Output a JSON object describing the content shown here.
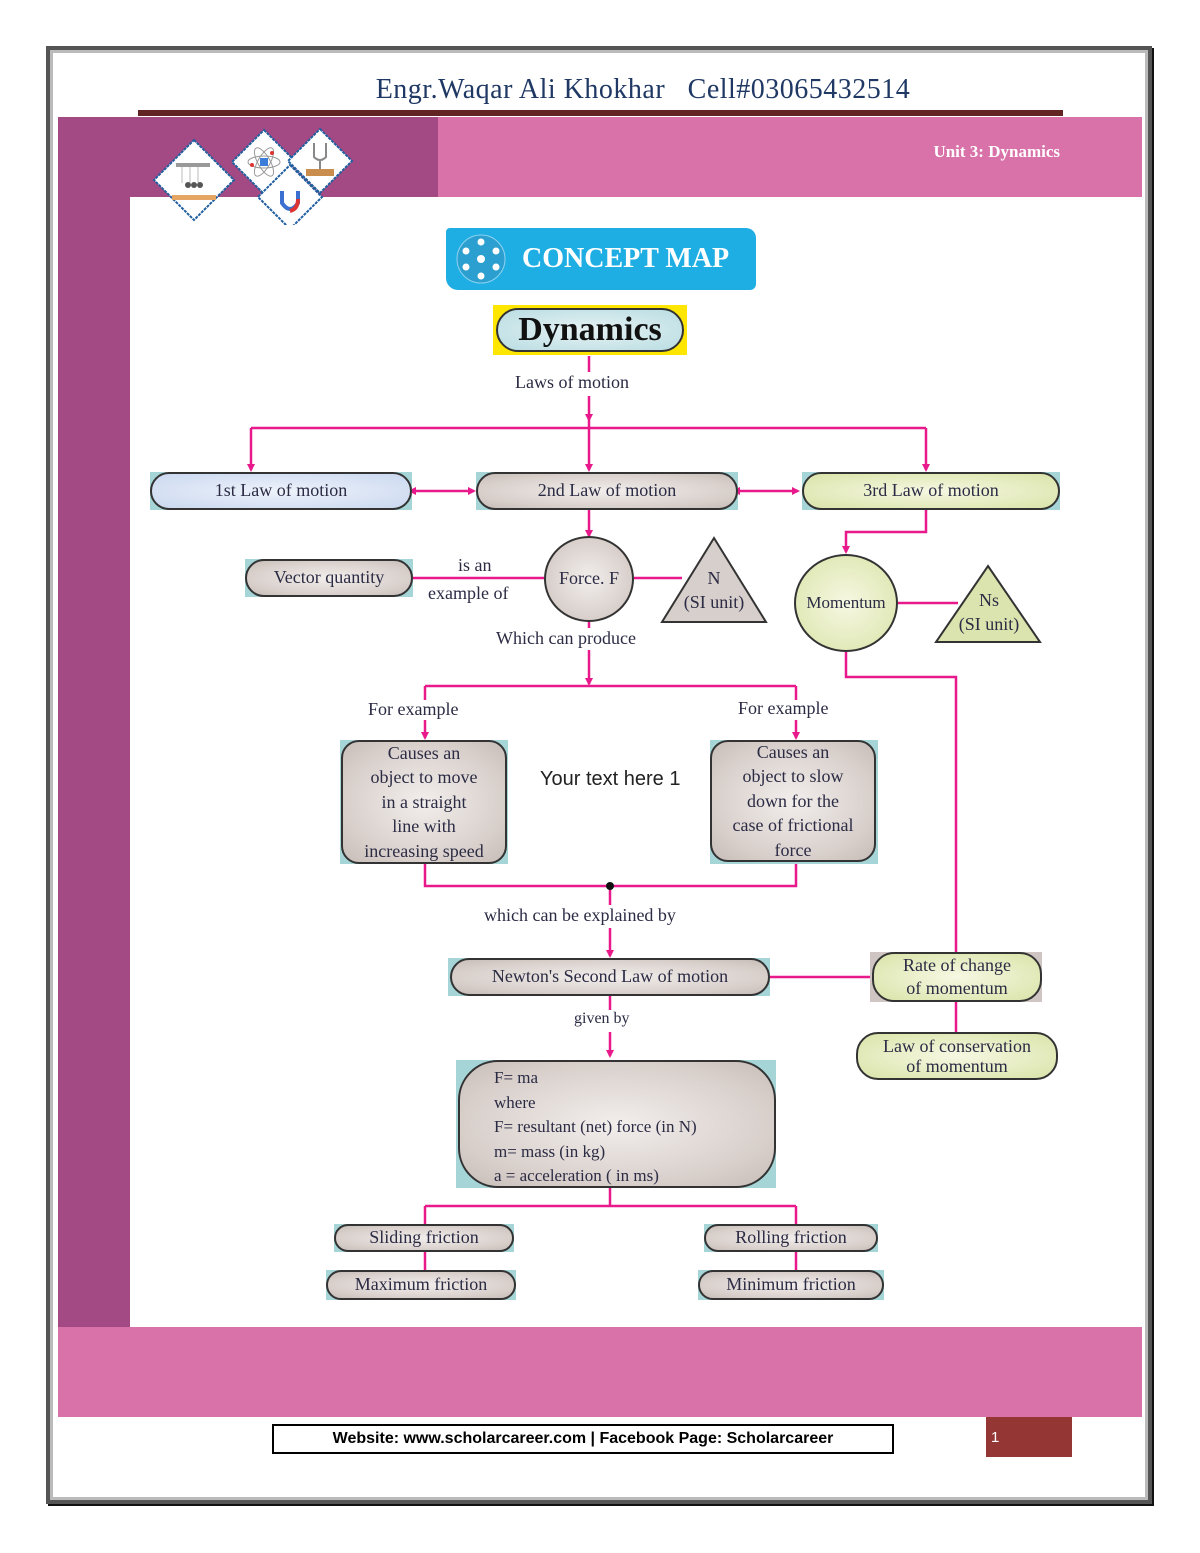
{
  "header": {
    "author_line": "Engr.Waqar Ali Khokhar   Cell#03065432514",
    "unit_label": "Unit  3: Dynamics"
  },
  "logo": {
    "icons": [
      "newtons-cradle-icon",
      "atom-icon",
      "tuning-fork-icon",
      "magnet-icon"
    ]
  },
  "banner": {
    "title": "CONCEPT MAP",
    "icon": "concept-map-icon"
  },
  "colors": {
    "band_dark": "#a34984",
    "band_light": "#d872a9",
    "rule": "#632523",
    "banner": "#1eaee3",
    "connector": "#e8198b",
    "page_badge": "#943634"
  },
  "map": {
    "root": "Dynamics",
    "root_link": "Laws of motion",
    "laws": [
      "1st Law of motion",
      "2nd Law of motion",
      "3rd Law of motion"
    ],
    "vector": "Vector quantity",
    "vector_link": [
      "is an",
      "example of"
    ],
    "force": "Force. F",
    "force_unit": [
      "N",
      "(SI unit)"
    ],
    "momentum": "Momentum",
    "momentum_unit": [
      "Ns",
      "(SI unit)"
    ],
    "produce_link": "Which can produce",
    "example_left_link": "For example",
    "example_right_link": "For example",
    "example_left": [
      "Causes an",
      "object to move",
      "in a straight",
      "line with",
      "increasing speed"
    ],
    "example_right": [
      "Causes an",
      "object to slow",
      "down for the",
      "case of frictional",
      "force"
    ],
    "placeholder_text": "Your text here 1",
    "explained_link": "which can be explained by",
    "newton2": "Newton's Second Law of motion",
    "rate_change": [
      "Rate of change",
      "of momentum"
    ],
    "conservation": [
      "Law of conservation",
      "of momentum"
    ],
    "given_link": "given by",
    "formula": [
      "F= ma",
      "where",
      "F= resultant (net) force (in N)",
      "m= mass (in kg)",
      "a = acceleration ( in ms)"
    ],
    "sliding": "Sliding friction",
    "rolling": "Rolling friction",
    "max_friction": "Maximum  friction",
    "min_friction": "Minimum friction"
  },
  "footer": {
    "website_line": "Website: www.scholarcareer.com | Facebook Page: Scholarcareer",
    "page_number": "1"
  }
}
